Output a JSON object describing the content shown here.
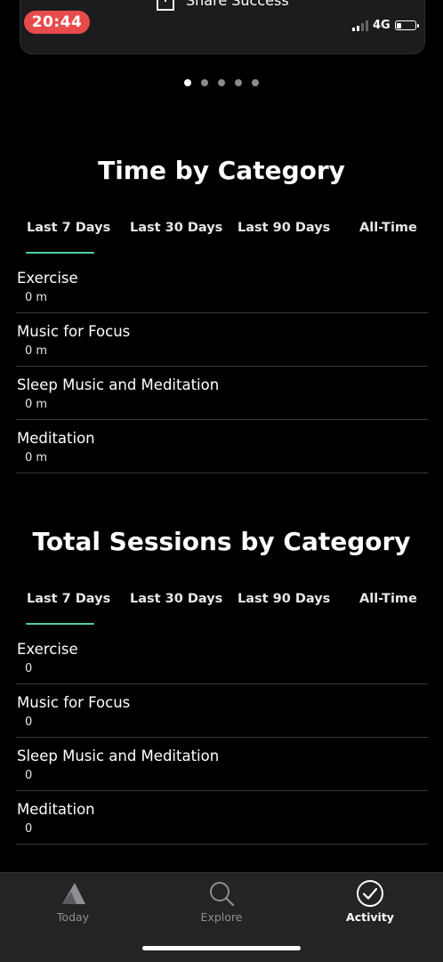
{
  "status_bar": {
    "time": "20:44",
    "network": "4G"
  },
  "share": {
    "label": "Share Success",
    "icon": "share-icon"
  },
  "pager": {
    "count": 5,
    "active_index": 0
  },
  "time_by_category": {
    "title": "Time by Category",
    "tabs": [
      {
        "label": "Last 7 Days",
        "active": true
      },
      {
        "label": "Last 30 Days",
        "active": false
      },
      {
        "label": "Last 90 Days",
        "active": false
      },
      {
        "label": "All-Time",
        "active": false
      }
    ],
    "rows": [
      {
        "label": "Exercise",
        "value": "0 m"
      },
      {
        "label": "Music for Focus",
        "value": "0 m"
      },
      {
        "label": "Sleep Music and Meditation",
        "value": "0 m"
      },
      {
        "label": "Meditation",
        "value": "0 m"
      }
    ]
  },
  "sessions_by_category": {
    "title": "Total Sessions by Category",
    "tabs": [
      {
        "label": "Last 7 Days",
        "active": true
      },
      {
        "label": "Last 30 Days",
        "active": false
      },
      {
        "label": "Last 90 Days",
        "active": false
      },
      {
        "label": "All-Time",
        "active": false
      }
    ],
    "rows": [
      {
        "label": "Exercise",
        "value": "0"
      },
      {
        "label": "Music for Focus",
        "value": "0"
      },
      {
        "label": "Sleep Music and Meditation",
        "value": "0"
      },
      {
        "label": "Meditation",
        "value": "0"
      }
    ]
  },
  "bottom_nav": [
    {
      "label": "Today",
      "icon": "mountain-icon",
      "active": false
    },
    {
      "label": "Explore",
      "icon": "search-icon",
      "active": false
    },
    {
      "label": "Activity",
      "icon": "checkmark-circle-icon",
      "active": true
    }
  ],
  "colors": {
    "background": "#000000",
    "accent_underline": "#4fd1a5",
    "time_pill": "#e84b4b",
    "nav_background": "#242424"
  }
}
